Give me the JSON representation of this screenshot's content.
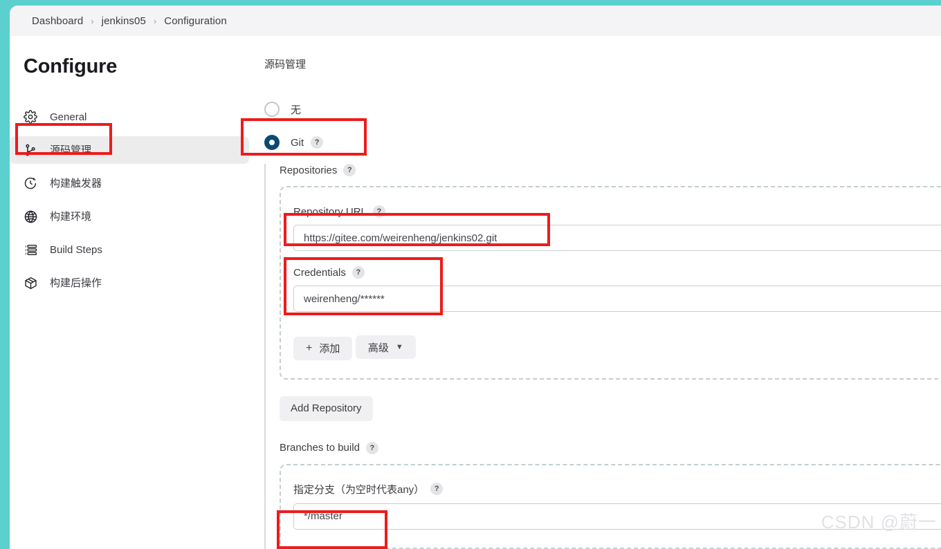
{
  "theme": {
    "desktop_teal": "#5ccfcf",
    "page_bg": "#ffffff",
    "breadcrumb_bg": "#f4f4f6",
    "accent_radio": "#0b4a72",
    "annotation_red": "#ee1b1b",
    "active_nav_bg": "#ececed"
  },
  "breadcrumb": {
    "items": [
      {
        "label": "Dashboard"
      },
      {
        "label": "jenkins05"
      },
      {
        "label": "Configuration"
      }
    ],
    "separator": "›"
  },
  "sidebar": {
    "title": "Configure",
    "items": [
      {
        "label": "General",
        "icon": "gear-icon",
        "active": false
      },
      {
        "label": "源码管理",
        "icon": "git-branch-icon",
        "active": true
      },
      {
        "label": "构建触发器",
        "icon": "clock-icon",
        "active": false
      },
      {
        "label": "构建环境",
        "icon": "globe-icon",
        "active": false
      },
      {
        "label": "Build Steps",
        "icon": "list-icon",
        "active": false
      },
      {
        "label": "构建后操作",
        "icon": "package-icon",
        "active": false
      }
    ]
  },
  "main": {
    "section_title": "源码管理",
    "scm_options": [
      {
        "label": "无",
        "selected": false,
        "has_help": false
      },
      {
        "label": "Git",
        "selected": true,
        "has_help": true
      }
    ],
    "help_glyph": "?",
    "repositories": {
      "label": "Repositories",
      "repository_url": {
        "label": "Repository URL",
        "value": "https://gitee.com/weirenheng/jenkins02.git"
      },
      "credentials": {
        "label": "Credentials",
        "value": "weirenheng/******"
      },
      "add_button": {
        "label": "添加",
        "plus": "+"
      },
      "advanced_button": {
        "label": "高级",
        "chevron": "∨"
      }
    },
    "add_repository_button": "Add Repository",
    "branches": {
      "label": "Branches to build",
      "branch_specifier": {
        "label": "指定分支（为空时代表any）",
        "value": "*/master"
      }
    }
  },
  "watermark": "CSDN @蔚一"
}
